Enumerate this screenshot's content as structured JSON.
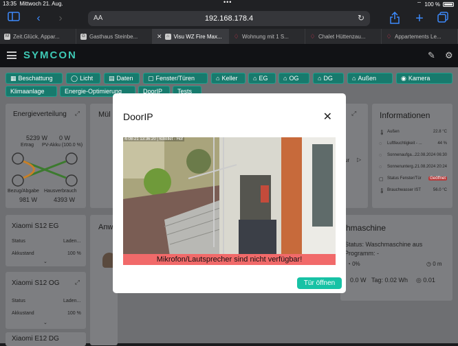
{
  "status_bar": {
    "time": "13:35",
    "date": "Mittwoch 21. Aug.",
    "battery": "100 %"
  },
  "browser": {
    "text_size_label": "AA",
    "url": "192.168.178.4",
    "tabs": [
      {
        "favicon": "M",
        "label": "Zeit.Glück, Appar...",
        "active": false
      },
      {
        "favicon": "G",
        "label": "Gasthaus Steinbe...",
        "active": false
      },
      {
        "favicon": "home",
        "label": "Visu WZ Fire Max...",
        "active": true
      },
      {
        "favicon": "airbnb",
        "label": "Wohnung mit 1 S...",
        "active": false
      },
      {
        "favicon": "airbnb",
        "label": "Chalet Hüttenzau...",
        "active": false
      },
      {
        "favicon": "airbnb",
        "label": "Appartements Le...",
        "active": false
      }
    ]
  },
  "app": {
    "logo": "SYMCON"
  },
  "nav_chips": {
    "row1": [
      {
        "label": "Beschattung",
        "icon": "shade-icon"
      },
      {
        "label": "Licht",
        "icon": "bulb-icon"
      },
      {
        "label": "Daten",
        "icon": "chart-icon"
      },
      {
        "label": "Fenster/Türen",
        "icon": "window-icon"
      },
      {
        "label": "Keller",
        "icon": "home-icon"
      },
      {
        "label": "EG",
        "icon": "home-icon"
      },
      {
        "label": "OG",
        "icon": "home-icon"
      },
      {
        "label": "DG",
        "icon": "home-icon"
      },
      {
        "label": "Außen",
        "icon": "home-icon"
      },
      {
        "label": "Kamera",
        "icon": "eye-icon"
      }
    ],
    "row2": [
      {
        "label": "Klimaanlage"
      },
      {
        "label": "Energie-Optimierung"
      },
      {
        "label": "DoorIP"
      },
      {
        "label": "Tests"
      }
    ]
  },
  "energy_card": {
    "title": "Energieverteilung",
    "ertrag_value": "5239 W",
    "ertrag_label": "Ertrag",
    "pv_value": "0 W",
    "pv_label": "PV-Akku (100.0 %)",
    "bezug_label": "Bezug/Abgabe",
    "bezug_value": "981 W",
    "haus_label": "Hausverbrauch",
    "haus_value": "4393 W"
  },
  "xiaomi_eg": {
    "title": "Xiaomi S12 EG",
    "status_label": "Status",
    "status_value": "Laden...",
    "akku_label": "Akkustand",
    "akku_value": "100 %"
  },
  "xiaomi_og": {
    "title": "Xiaomi S12 OG",
    "status_label": "Status",
    "status_value": "Laden...",
    "akku_label": "Akkustand",
    "akku_value": "100 %"
  },
  "xiaomi_dg": {
    "title": "Xiaomi E12 DG"
  },
  "partial_cards": {
    "mid_top": "Mül",
    "mid_bottom": "Anw",
    "right_mid": "ur"
  },
  "info_card": {
    "title": "Informationen",
    "rows": [
      {
        "label": "Außen",
        "value": "22.8 °C"
      },
      {
        "label": "Luftfeuchtigkeit - ...",
        "value": "44 %"
      },
      {
        "label": "Sonnenaufga...",
        "value": "22.08.2024 06:30"
      },
      {
        "label": "Sonnenunterg...",
        "value": "21.08.2024 20:24"
      },
      {
        "label": "Status Fenster/Tür",
        "value": "Geöffnet"
      },
      {
        "label": "Brauchwasser IST",
        "value": "56.0 °C"
      }
    ]
  },
  "washer_card": {
    "title": "hmaschine",
    "status_line": "Status: Waschmaschine aus",
    "program_line": "Programm: -",
    "percent": "0%",
    "time_left": "0 m",
    "power": "0.0 W",
    "day": "Tag: 0.02 Wh",
    "extra": "0.01"
  },
  "modal": {
    "title": "DoorIP",
    "camera_timestamp": "4-08-21 13:36:20 | 63Billet - Hof",
    "camera_message": "Mikrofon/Lautsprecher sind nicht verfügbar!",
    "open_button": "Tür öffnen"
  },
  "colors": {
    "accent": "#17c2a5",
    "chip": "#177a6d",
    "alert": "#f16a6a"
  }
}
